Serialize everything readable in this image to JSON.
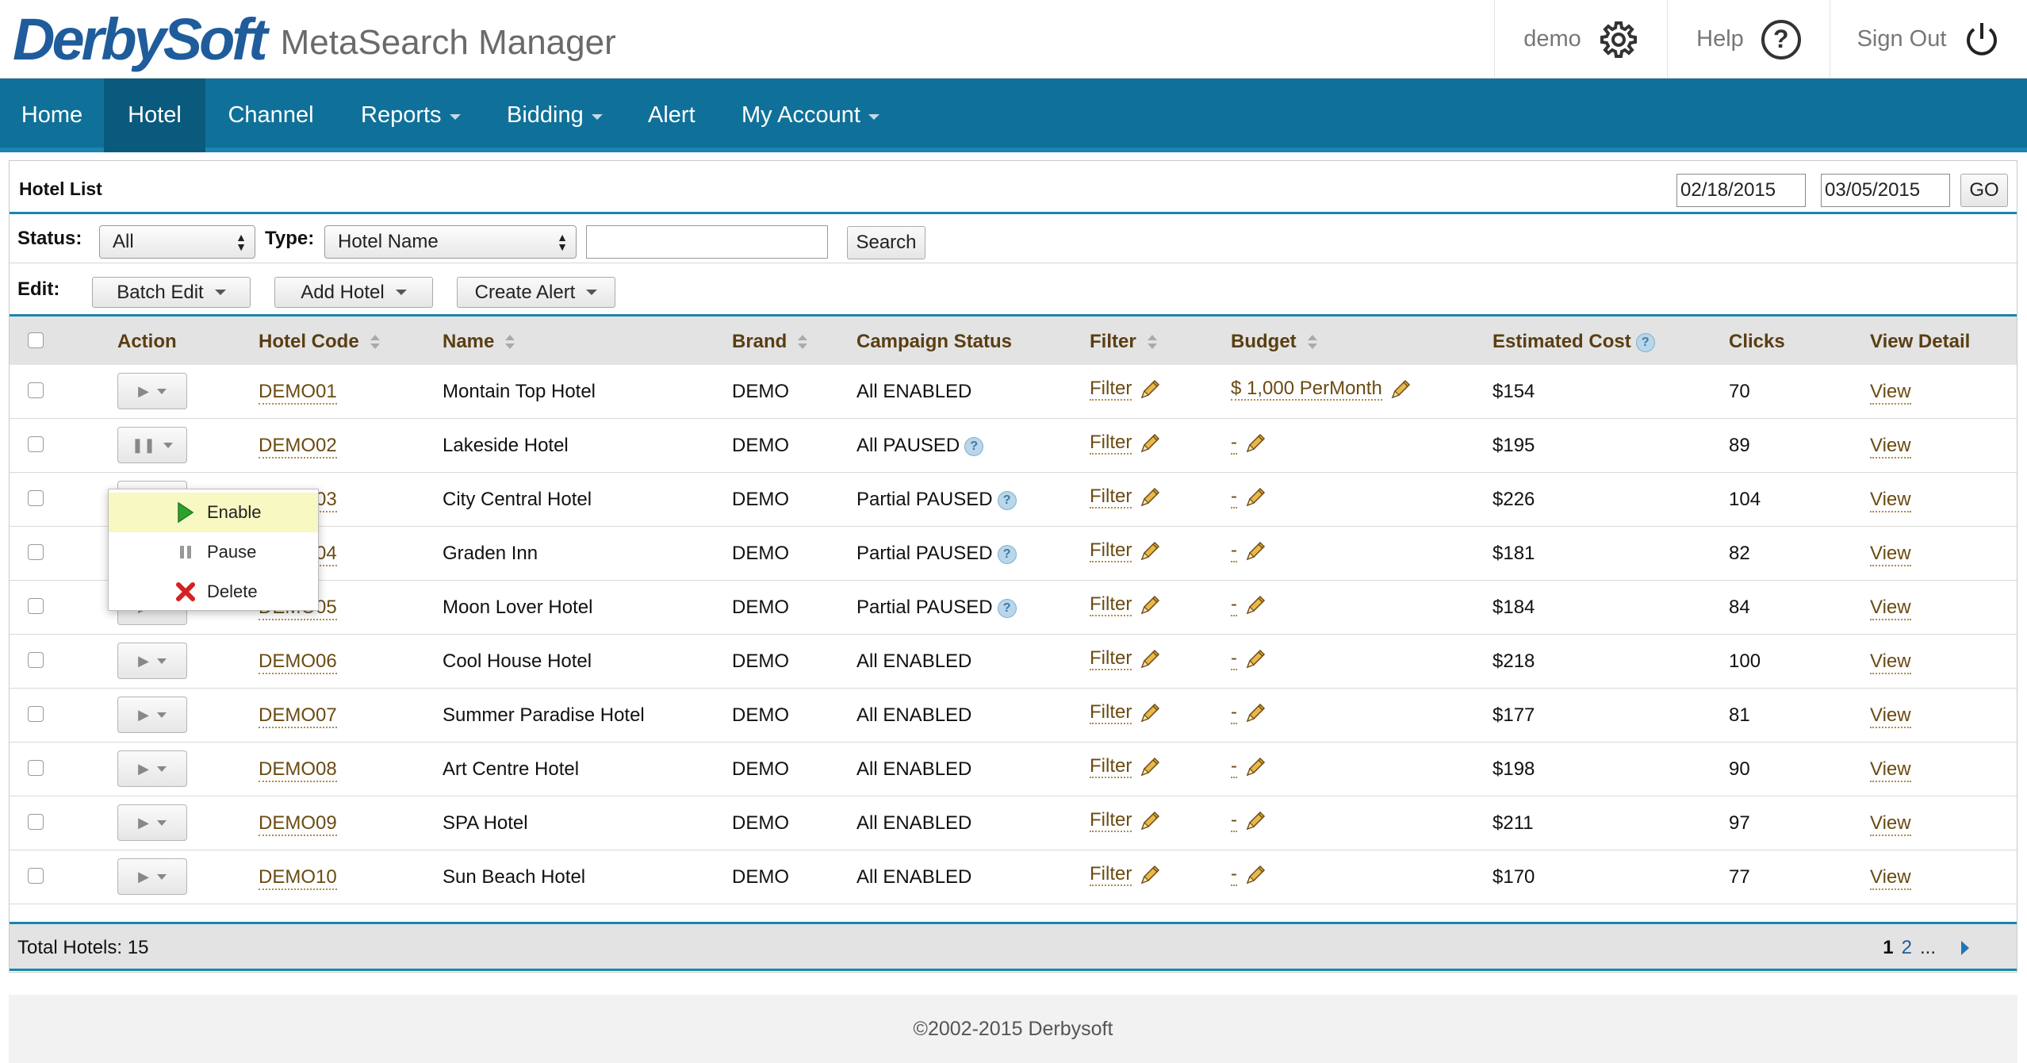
{
  "header": {
    "brand": "DerbySoft",
    "product": "MetaSearch Manager",
    "user": "demo",
    "help": "Help",
    "signout": "Sign Out"
  },
  "nav": {
    "items": [
      {
        "label": "Home"
      },
      {
        "label": "Hotel"
      },
      {
        "label": "Channel"
      },
      {
        "label": "Reports"
      },
      {
        "label": "Bidding"
      },
      {
        "label": "Alert"
      },
      {
        "label": "My Account"
      }
    ],
    "active": "Hotel"
  },
  "panel": {
    "title": "Hotel List",
    "date_from": "02/18/2015",
    "date_to": "03/05/2015",
    "go": "GO"
  },
  "filters": {
    "status_label": "Status:",
    "status_value": "All",
    "type_label": "Type:",
    "type_value": "Hotel Name",
    "search_value": "",
    "search_button": "Search"
  },
  "edit": {
    "label": "Edit:",
    "batch_edit": "Batch Edit",
    "add_hotel": "Add Hotel",
    "create_alert": "Create Alert"
  },
  "table": {
    "headers": {
      "action": "Action",
      "code": "Hotel Code",
      "name": "Name",
      "brand": "Brand",
      "status": "Campaign Status",
      "filter": "Filter",
      "budget": "Budget",
      "cost": "Estimated Cost",
      "clicks": "Clicks",
      "detail": "View Detail"
    },
    "rows": [
      {
        "code": "DEMO01",
        "name": "Montain Top Hotel",
        "brand": "DEMO",
        "status": "All ENABLED",
        "filter": "Filter",
        "budget": "$ 1,000 PerMonth",
        "cost": "$154",
        "clicks": "70",
        "view": "View"
      },
      {
        "code": "DEMO02",
        "name": "Lakeside Hotel",
        "brand": "DEMO",
        "status": "All PAUSED",
        "filter": "Filter",
        "budget": "-",
        "cost": "$195",
        "clicks": "89",
        "view": "View"
      },
      {
        "code": "DEMO03",
        "name": "City Central Hotel",
        "brand": "DEMO",
        "status": "Partial PAUSED",
        "filter": "Filter",
        "budget": "-",
        "cost": "$226",
        "clicks": "104",
        "view": "View"
      },
      {
        "code": "DEMO04",
        "name": "Graden Inn",
        "brand": "DEMO",
        "status": "Partial PAUSED",
        "filter": "Filter",
        "budget": "-",
        "cost": "$181",
        "clicks": "82",
        "view": "View"
      },
      {
        "code": "DEMO05",
        "name": "Moon Lover Hotel",
        "brand": "DEMO",
        "status": "Partial PAUSED",
        "filter": "Filter",
        "budget": "-",
        "cost": "$184",
        "clicks": "84",
        "view": "View"
      },
      {
        "code": "DEMO06",
        "name": "Cool House Hotel",
        "brand": "DEMO",
        "status": "All ENABLED",
        "filter": "Filter",
        "budget": "-",
        "cost": "$218",
        "clicks": "100",
        "view": "View"
      },
      {
        "code": "DEMO07",
        "name": "Summer Paradise Hotel",
        "brand": "DEMO",
        "status": "All ENABLED",
        "filter": "Filter",
        "budget": "-",
        "cost": "$177",
        "clicks": "81",
        "view": "View"
      },
      {
        "code": "DEMO08",
        "name": "Art Centre Hotel",
        "brand": "DEMO",
        "status": "All ENABLED",
        "filter": "Filter",
        "budget": "-",
        "cost": "$198",
        "clicks": "90",
        "view": "View"
      },
      {
        "code": "DEMO09",
        "name": "SPA Hotel",
        "brand": "DEMO",
        "status": "All ENABLED",
        "filter": "Filter",
        "budget": "-",
        "cost": "$211",
        "clicks": "97",
        "view": "View"
      },
      {
        "code": "DEMO10",
        "name": "Sun Beach Hotel",
        "brand": "DEMO",
        "status": "All ENABLED",
        "filter": "Filter",
        "budget": "-",
        "cost": "$170",
        "clicks": "77",
        "view": "View"
      }
    ]
  },
  "action_menu": {
    "items": [
      {
        "label": "Enable",
        "icon": "play-icon"
      },
      {
        "label": "Pause",
        "icon": "pause-icon"
      },
      {
        "label": "Delete",
        "icon": "delete-x-icon"
      }
    ]
  },
  "footer": {
    "total": "Total Hotels: 15",
    "page_current": "1",
    "page_next": "2",
    "ellipsis": "...",
    "copyright": "©2002-2015 Derbysoft"
  },
  "colors": {
    "nav_bg": "#0f7199",
    "nav_active": "#0a5a7d",
    "accent": "#1a85b0",
    "link": "#6b4b13",
    "brand_blue": "#1f5c9c"
  }
}
